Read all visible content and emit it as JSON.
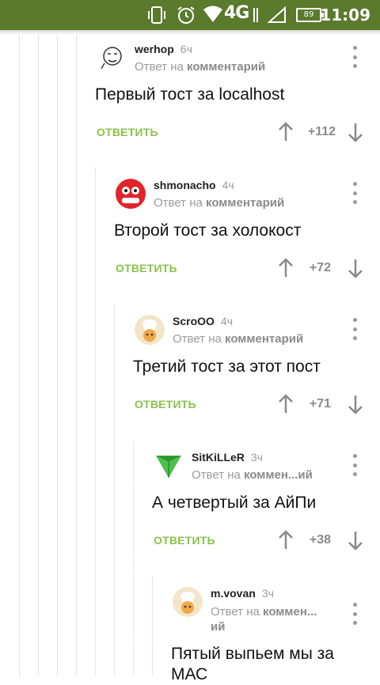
{
  "status_bar": {
    "time": "11:09",
    "network": "4G",
    "battery": "89"
  },
  "colors": {
    "status_bar": "#5a7a2c",
    "reply": "#8ac24a",
    "muted": "#9a9a9a"
  },
  "comments": [
    {
      "author": "werhop",
      "time": "6ч",
      "reply_prefix": "Ответ на",
      "reply_target": "комментарий",
      "text": "Первый тост за localhost",
      "reply_label": "ОТВЕТИТЬ",
      "score": "+112",
      "avatar_icon": "meme-face-icon"
    },
    {
      "author": "shmonacho",
      "time": "4ч",
      "reply_prefix": "Ответ на",
      "reply_target": "комментарий",
      "text": "Второй тост за холокост",
      "reply_label": "ОТВЕТИТЬ",
      "score": "+72",
      "avatar_icon": "red-cartoon-icon"
    },
    {
      "author": "ScroOO",
      "time": "4ч",
      "reply_prefix": "Ответ на",
      "reply_target": "комментарий",
      "text": "Третий тост за этот пост",
      "reply_label": "ОТВЕТИТЬ",
      "score": "+71",
      "avatar_icon": "chef-icon"
    },
    {
      "author": "SitKiLLeR",
      "time": "3ч",
      "reply_prefix": "Ответ на",
      "reply_target": "коммен...ий",
      "text": "А четвертый за АйПи",
      "reply_label": "ОТВЕТИТЬ",
      "score": "+38",
      "avatar_icon": "green-triangle-icon"
    },
    {
      "author": "m.vovan",
      "time": "3ч",
      "reply_prefix": "Ответ на",
      "reply_target": "коммен...",
      "reply_target_cont": "ий",
      "text": "Пятый выпьем мы за",
      "text_cont": "МАС",
      "avatar_icon": "chef-icon"
    }
  ]
}
